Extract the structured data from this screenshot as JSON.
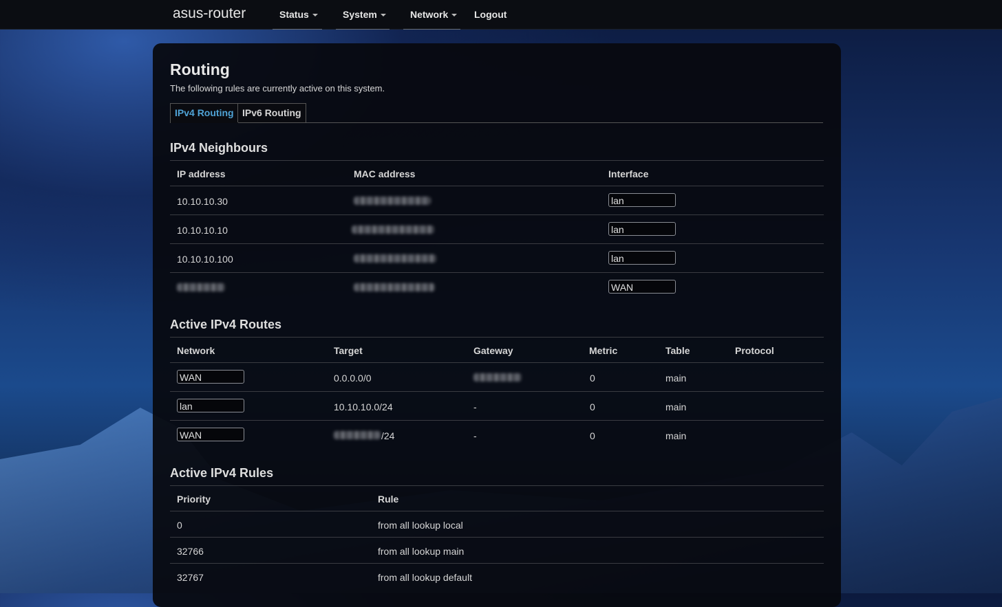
{
  "navbar": {
    "brand": "asus-router",
    "items": [
      {
        "label": "Status"
      },
      {
        "label": "System"
      },
      {
        "label": "Network"
      },
      {
        "label": "Logout"
      }
    ]
  },
  "page": {
    "title": "Routing",
    "description": "The following rules are currently active on this system.",
    "tabs": [
      {
        "label": "IPv4 Routing",
        "active": true
      },
      {
        "label": "IPv6 Routing",
        "active": false
      }
    ]
  },
  "neighbours": {
    "heading": "IPv4 Neighbours",
    "columns": [
      "IP address",
      "MAC address",
      "Interface"
    ],
    "rows": [
      {
        "ip": "10.10.10.30",
        "interface": "lan"
      },
      {
        "ip": "10.10.10.10",
        "interface": "lan"
      },
      {
        "ip": "10.10.10.100",
        "interface": "lan"
      },
      {
        "ip": "",
        "interface": "WAN"
      }
    ]
  },
  "routes": {
    "heading": "Active IPv4 Routes",
    "columns": [
      "Network",
      "Target",
      "Gateway",
      "Metric",
      "Table",
      "Protocol"
    ],
    "rows": [
      {
        "network": "WAN",
        "target": "0.0.0.0/0",
        "gateway": "",
        "metric": "0",
        "table": "main",
        "protocol": ""
      },
      {
        "network": "lan",
        "target": "10.10.10.0/24",
        "gateway": "-",
        "metric": "0",
        "table": "main",
        "protocol": ""
      },
      {
        "network": "WAN",
        "target": "/24",
        "gateway": "-",
        "metric": "0",
        "table": "main",
        "protocol": ""
      }
    ]
  },
  "rules": {
    "heading": "Active IPv4 Rules",
    "columns": [
      "Priority",
      "Rule"
    ],
    "rows": [
      {
        "priority": "0",
        "rule": "from all lookup local"
      },
      {
        "priority": "32766",
        "rule": "from all lookup main"
      },
      {
        "priority": "32767",
        "rule": "from all lookup default"
      }
    ]
  },
  "colors": {
    "accent": "#4fa3d6",
    "panel": "#08090e",
    "navbar": "#0b0d12"
  }
}
